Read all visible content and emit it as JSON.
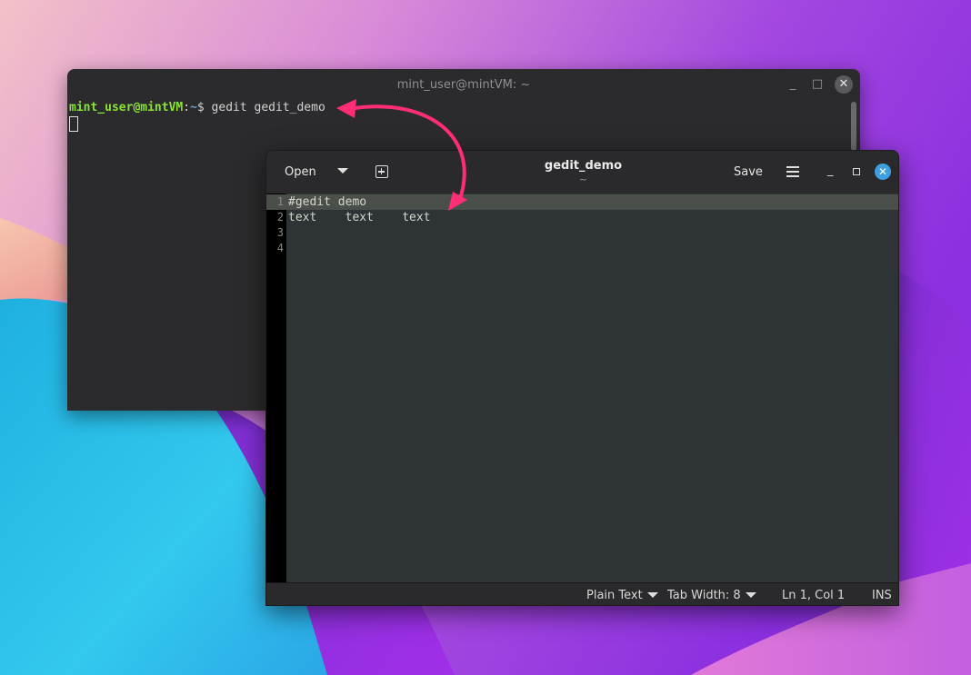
{
  "terminal": {
    "title": "mint_user@mintVM: ~",
    "minimize_icon": "minimize-icon",
    "maximize_icon": "maximize-icon",
    "close_icon": "close-icon",
    "prompt_user": "mint_user@mintVM",
    "prompt_sep": ":",
    "prompt_path": "~",
    "prompt_symbol": "$ ",
    "command": "gedit gedit_demo"
  },
  "gedit": {
    "open_label": "Open",
    "open_dropdown_icon": "chevron-down-icon",
    "new_tab_icon": "new-tab-icon",
    "title": "gedit_demo",
    "subtitle": "~",
    "save_label": "Save",
    "menu_icon": "hamburger-menu-icon",
    "close_icon": "close-icon",
    "lines": [
      {
        "number": "1",
        "text": "#gedit demo"
      },
      {
        "number": "2",
        "text": "text    text    text"
      },
      {
        "number": "3",
        "text": ""
      },
      {
        "number": "4",
        "text": ""
      }
    ],
    "status": {
      "language": "Plain Text",
      "tab_width": "Tab Width: 8",
      "position": "Ln 1, Col 1",
      "mode": "INS"
    }
  },
  "colors": {
    "annotation_arrow": "#ff2d78",
    "close_button": "#3d9fe0",
    "prompt_user": "#8ae234",
    "prompt_path": "#729fcf"
  }
}
